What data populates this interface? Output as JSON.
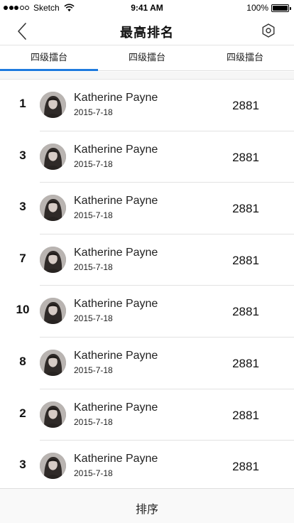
{
  "status_bar": {
    "carrier": "Sketch",
    "time": "9:41 AM",
    "battery": "100%"
  },
  "nav": {
    "title": "最高排名"
  },
  "tabs": [
    {
      "label": "四级擂台",
      "active": true
    },
    {
      "label": "四级擂台",
      "active": false
    },
    {
      "label": "四级擂台",
      "active": false
    }
  ],
  "rankings": [
    {
      "rank": "1",
      "name": "Katherine Payne",
      "date": "2015-7-18",
      "score": "2881"
    },
    {
      "rank": "3",
      "name": "Katherine Payne",
      "date": "2015-7-18",
      "score": "2881"
    },
    {
      "rank": "3",
      "name": "Katherine Payne",
      "date": "2015-7-18",
      "score": "2881"
    },
    {
      "rank": "7",
      "name": "Katherine Payne",
      "date": "2015-7-18",
      "score": "2881"
    },
    {
      "rank": "10",
      "name": "Katherine Payne",
      "date": "2015-7-18",
      "score": "2881"
    },
    {
      "rank": "8",
      "name": "Katherine Payne",
      "date": "2015-7-18",
      "score": "2881"
    },
    {
      "rank": "2",
      "name": "Katherine Payne",
      "date": "2015-7-18",
      "score": "2881"
    },
    {
      "rank": "3",
      "name": "Katherine Payne",
      "date": "2015-7-18",
      "score": "2881"
    }
  ],
  "bottom_bar": {
    "sort_label": "排序"
  },
  "colors": {
    "accent": "#1f7bde"
  }
}
